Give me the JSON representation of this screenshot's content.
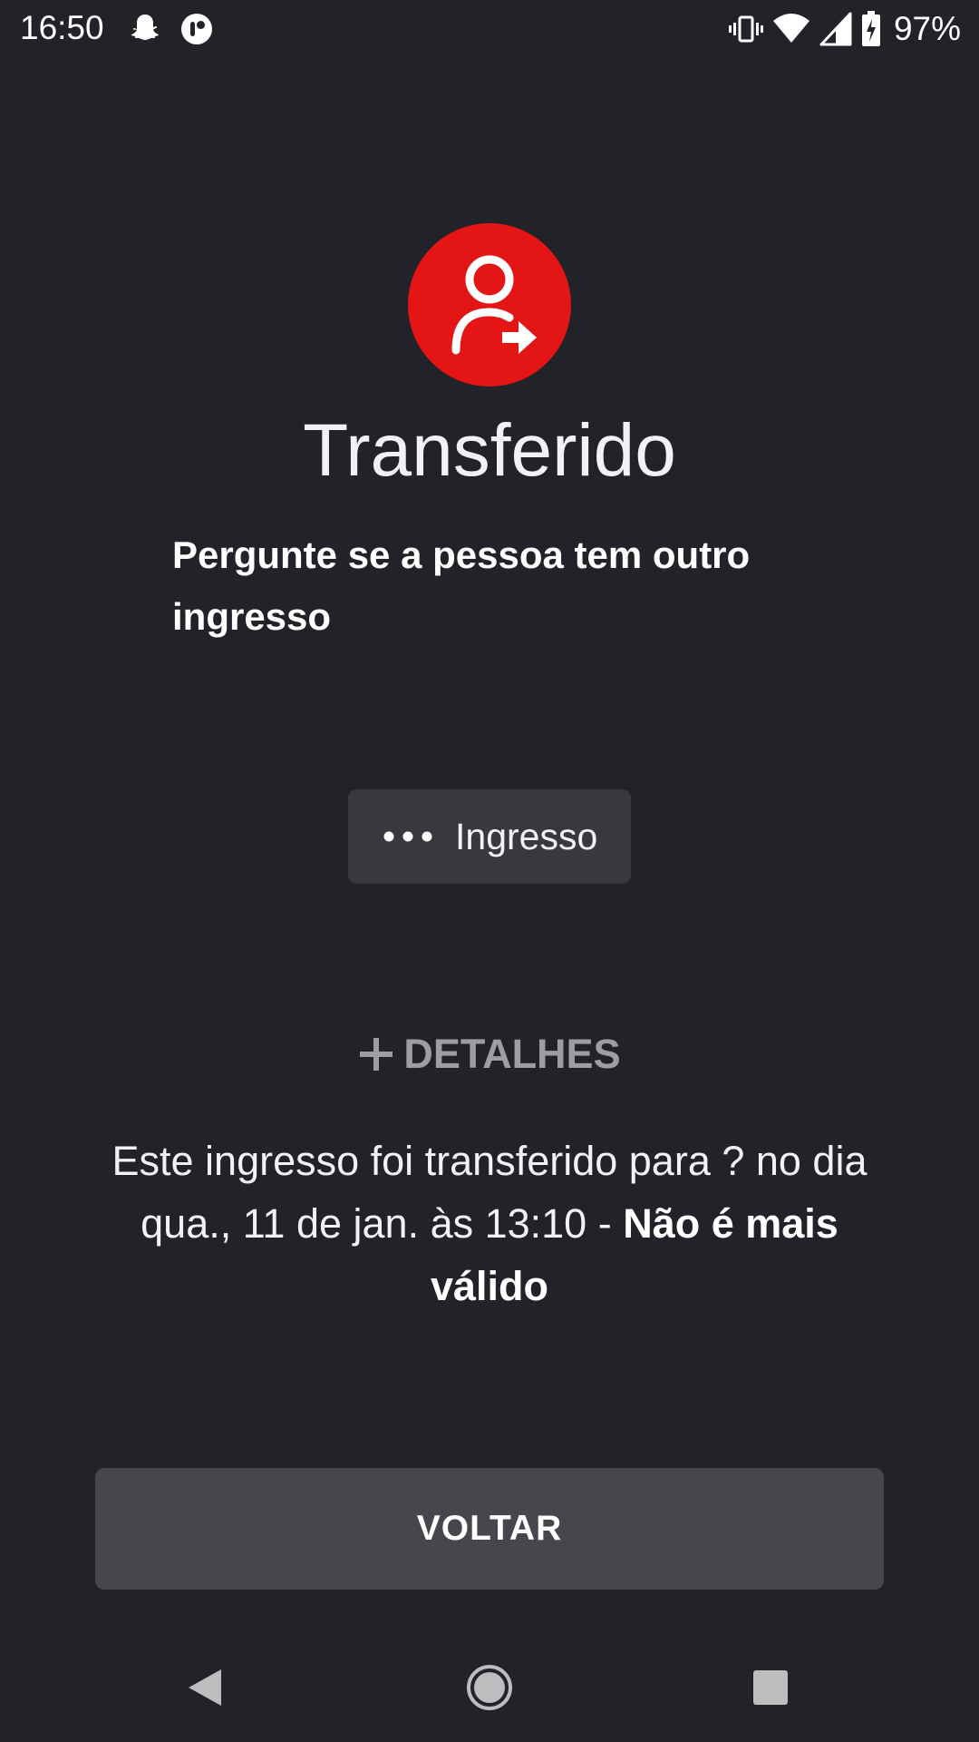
{
  "status_bar": {
    "time": "16:50",
    "battery": "97%",
    "left_icons": [
      "snapchat-icon",
      "app-notification-icon"
    ],
    "right_icons": [
      "vibrate-icon",
      "wifi-icon",
      "cellular-signal-icon",
      "battery-charging-icon"
    ]
  },
  "hero": {
    "icon": "person-transfer-icon",
    "icon_bg_color": "#e41515",
    "title": "Transferido",
    "subtitle": "Pergunte se a pessoa tem outro ingresso"
  },
  "ticket_chip": {
    "icon": "more-dots-icon",
    "label": "Ingresso"
  },
  "details": {
    "icon": "plus-icon",
    "label": "DETALHES"
  },
  "info": {
    "text": "Este ingresso foi transferido para ? no dia qua., 11 de jan. às 13:10 - ",
    "emphasis": "Não é mais válido"
  },
  "back_button": {
    "label": "VOLTAR"
  },
  "nav_bar": {
    "icons": [
      "back-triangle-icon",
      "home-circle-icon",
      "recents-square-icon"
    ]
  },
  "colors": {
    "background": "#222328",
    "chip": "#38393e",
    "button": "#46474c",
    "accent_red": "#e41515",
    "muted_text": "#9d9ea3"
  }
}
